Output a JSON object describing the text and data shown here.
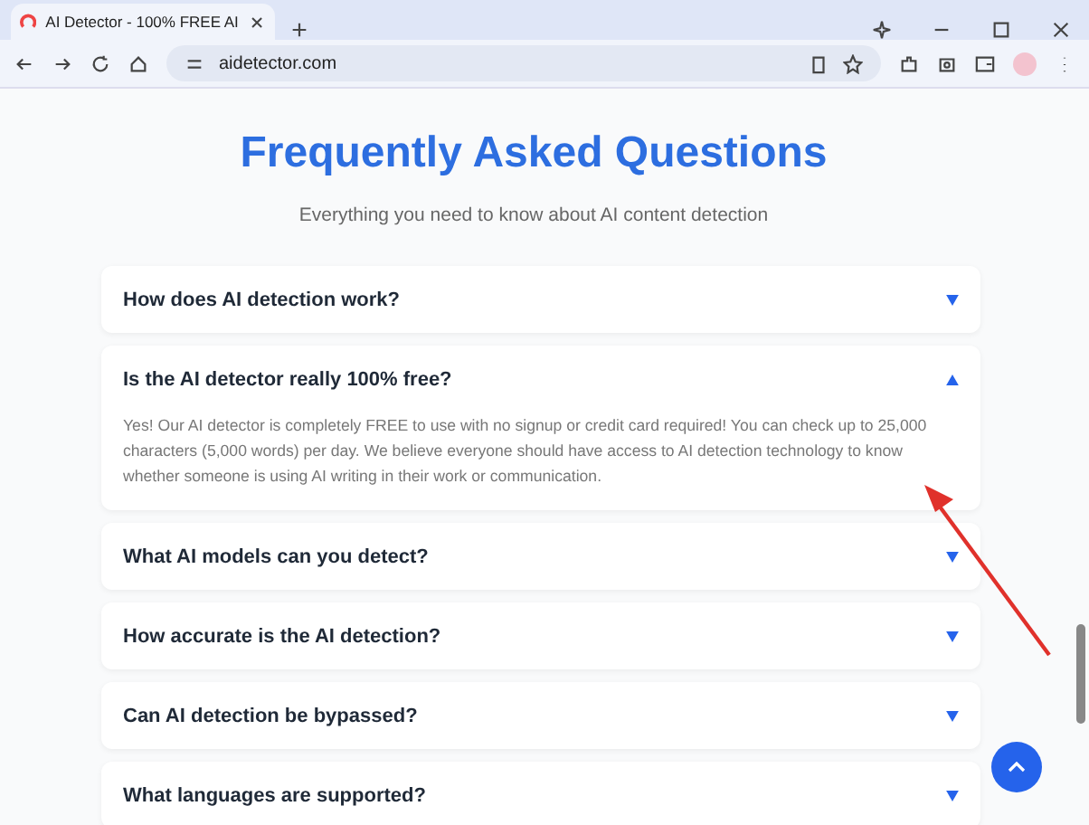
{
  "browser": {
    "tab_title": "AI Detector - 100% FREE AI",
    "url": "aidetector.com"
  },
  "page": {
    "title": "Frequently Asked Questions",
    "subtitle": "Everything you need to know about AI content detection"
  },
  "faq": [
    {
      "question": "How does AI detection work?",
      "expanded": false
    },
    {
      "question": "Is the AI detector really 100% free?",
      "expanded": true,
      "answer": "Yes! Our AI detector is completely FREE to use with no signup or credit card required! You can check up to 25,000 characters (5,000 words) per day. We believe everyone should have access to AI detection technology to know whether someone is using AI writing in their work or communication."
    },
    {
      "question": "What AI models can you detect?",
      "expanded": false
    },
    {
      "question": "How accurate is the AI detection?",
      "expanded": false
    },
    {
      "question": "Can AI detection be bypassed?",
      "expanded": false
    },
    {
      "question": "What languages are supported?",
      "expanded": false
    }
  ]
}
